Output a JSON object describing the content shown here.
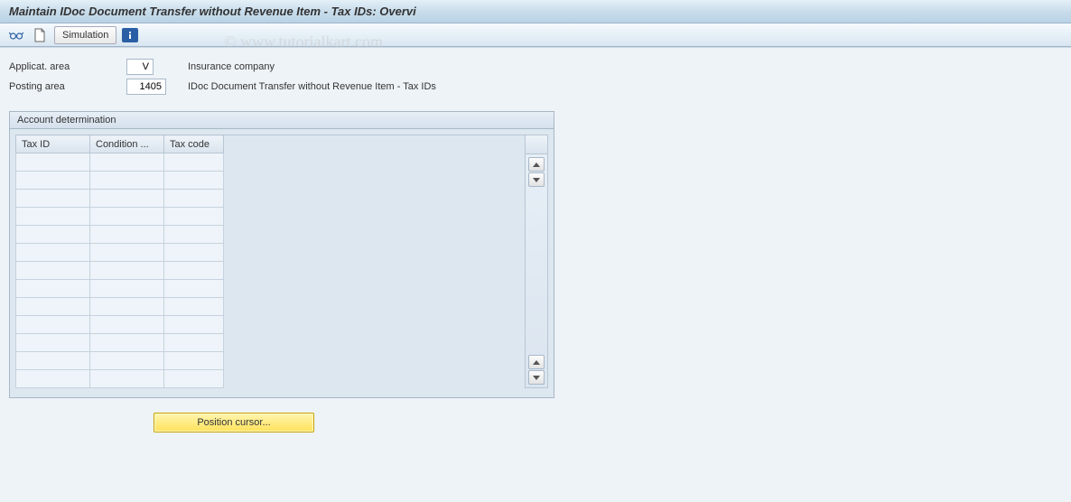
{
  "title": "Maintain IDoc Document Transfer without Revenue Item - Tax IDs: Overvi",
  "watermark": "© www.tutorialkart.com",
  "toolbar": {
    "simulation_label": "Simulation"
  },
  "fields": {
    "applicat_area": {
      "label": "Applicat. area",
      "value": "V",
      "desc": "Insurance company"
    },
    "posting_area": {
      "label": "Posting area",
      "value": "1405",
      "desc": "IDoc Document Transfer without Revenue Item - Tax IDs"
    }
  },
  "panel": {
    "title": "Account determination",
    "columns": {
      "tax_id": "Tax ID",
      "condition": "Condition ...",
      "tax_code": "Tax code"
    },
    "row_count": 13
  },
  "position_button": "Position cursor..."
}
